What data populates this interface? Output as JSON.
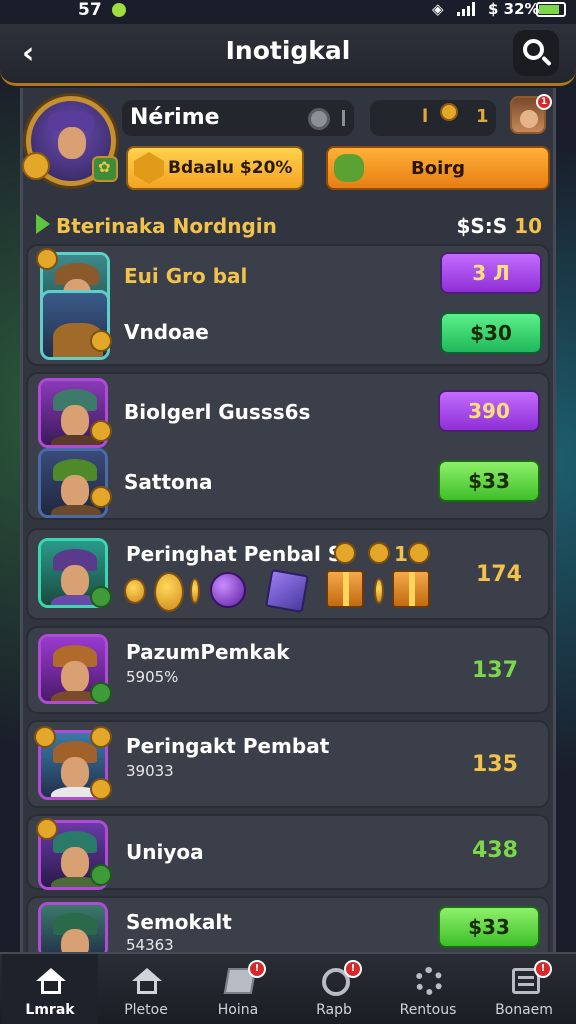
{
  "status": {
    "time": "57",
    "battery": "$ 32%"
  },
  "header": {
    "title": "Inotigkal"
  },
  "profile": {
    "name": "Nérime",
    "currency_prefix": "l",
    "currency_value": "1",
    "notif_count": "1"
  },
  "buttons": {
    "gold_label": "Bdaalu $20%",
    "orange_label": "Boirg"
  },
  "section": {
    "title": "Bterinaka Nordngin",
    "right_prefix": "$S:S",
    "right_value": "10"
  },
  "items": [
    {
      "name": "Eui Gro bal",
      "price": "3 Л"
    },
    {
      "name": "Vndoae",
      "price": "$30"
    },
    {
      "name": "Biolgerl Gusss6s",
      "price": "390"
    },
    {
      "name": "Sattona",
      "price": "$33"
    },
    {
      "name": "Peringhat Penbal S",
      "extra": "1",
      "value": "174"
    },
    {
      "name": "PazumPemkak",
      "sub": "5905%",
      "value": "137"
    },
    {
      "name": "Peringakt Pembat",
      "sub": "39033",
      "value": "135"
    },
    {
      "name": "Uniyoa",
      "value": "438"
    },
    {
      "name": "Semokalt",
      "sub": "54363",
      "price": "$33"
    }
  ],
  "nav": [
    {
      "label": "Lmrak",
      "icon": "home-icon"
    },
    {
      "label": "Pletoe",
      "icon": "house-icon"
    },
    {
      "label": "Hoina",
      "icon": "map-icon",
      "badge": "!"
    },
    {
      "label": "Rapb",
      "icon": "disc-icon",
      "badge": "!"
    },
    {
      "label": "Rentous",
      "icon": "gear-icon"
    },
    {
      "label": "Bonaem",
      "icon": "list-icon",
      "badge": "!"
    }
  ],
  "colors": {
    "accent_gold": "#f2c24a",
    "purple_btn": "#8e2fd6",
    "green_btn": "#1fb85a",
    "panel": "#31353f"
  }
}
